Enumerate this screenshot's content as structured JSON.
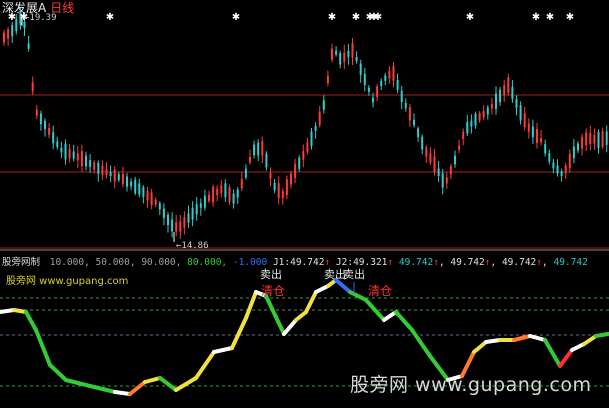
{
  "title": {
    "stock_name": "深发展A",
    "period": "日线"
  },
  "price_panel": {
    "high_label": "←19.39",
    "low_label": "←14.86",
    "high_value": 19.39,
    "low_value": 14.86
  },
  "indicator": {
    "name": "股旁网制",
    "params": [
      "10.000,",
      "50.000,",
      "90.000,",
      "80.000,",
      "-1.000"
    ],
    "j1_label": "J1:",
    "j1_value": "49.742",
    "j2_label": "J2:",
    "j2_value": "49.321",
    "extra_values": [
      "49.742",
      "49.742",
      "49.742",
      "49.742"
    ],
    "arrow": "↑",
    "sell_label": "卖出",
    "clear_label": "清仓",
    "levels": [
      90,
      80,
      50,
      10
    ]
  },
  "watermark": {
    "top_text": "股旁网 www.gupang.com",
    "bottom_text": "股旁网 www.gupang.com"
  },
  "colors": {
    "background": "#000000",
    "up_candle": "#ff3a3a",
    "down_candle": "#33cccc",
    "grid": "#b01818",
    "signal_green": "#33cc33",
    "signal_yellow": "#f0e040",
    "signal_white": "#ffffff"
  }
}
